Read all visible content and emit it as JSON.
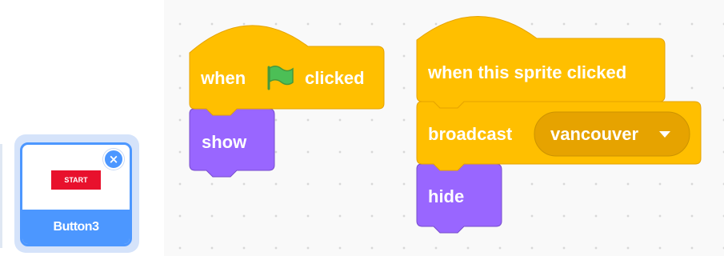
{
  "sprite_pane": {
    "sprite": {
      "name": "Button3",
      "thumbnail_text": "START",
      "delete_icon": "close-icon"
    }
  },
  "scripts": [
    {
      "hat": {
        "before_icon": "when",
        "icon": "green-flag-icon",
        "after_icon": "clicked"
      },
      "stack": [
        {
          "label": "show"
        }
      ]
    },
    {
      "hat": {
        "label": "when this sprite clicked"
      },
      "stack": [
        {
          "label": "broadcast",
          "dropdown": {
            "value": "vancouver",
            "icon": "caret-down-icon"
          }
        },
        {
          "label": "hide"
        }
      ]
    }
  ],
  "colors": {
    "events": "#ffbf00",
    "events_border": "#e6a300",
    "looks": "#9966ff",
    "looks_border": "#774dcb",
    "flag_green": "#4cbf56",
    "selected": "#4c97ff"
  }
}
